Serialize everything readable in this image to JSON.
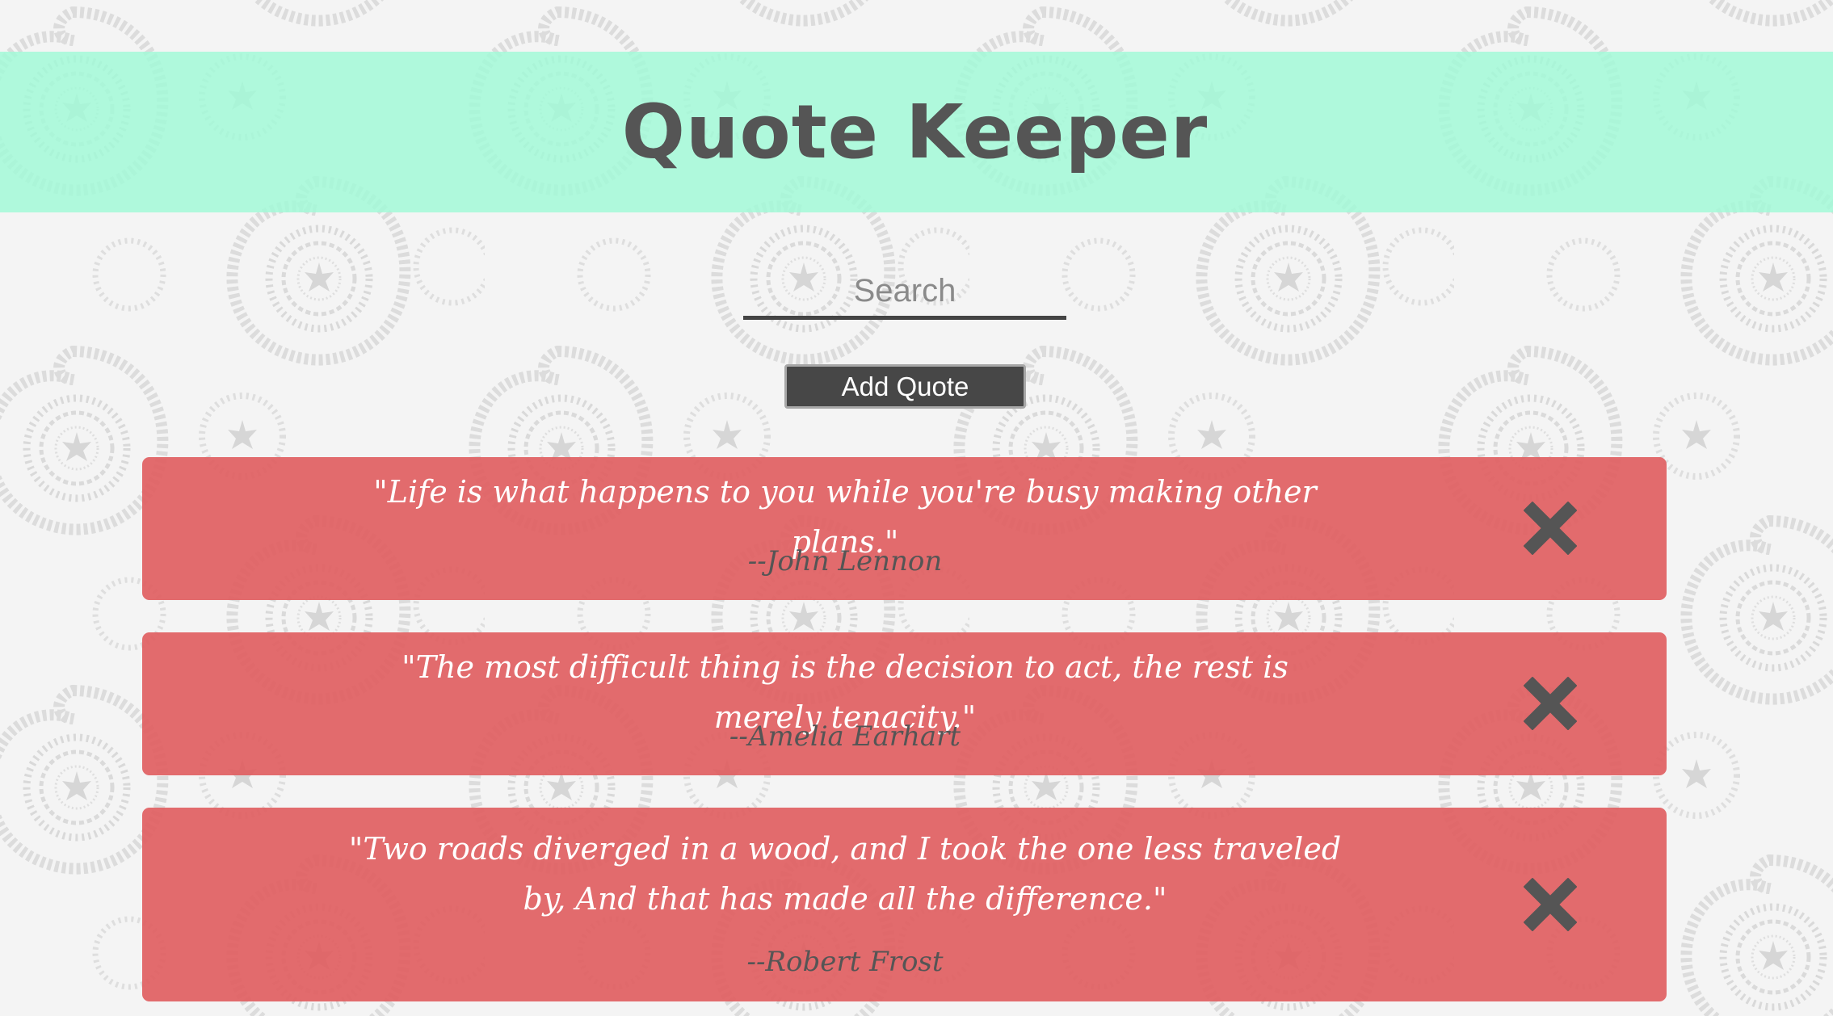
{
  "header": {
    "title": "Quote Keeper"
  },
  "search": {
    "placeholder": "Search"
  },
  "toolbar": {
    "add_label": "Add Quote"
  },
  "quotes": [
    {
      "text": "\"Life is what happens to you while you're busy making other plans.\"",
      "author": "--John Lennon"
    },
    {
      "text": "\"The most difficult thing is the decision to act, the rest is merely tenacity.\"",
      "author": "--Amelia Earhart"
    },
    {
      "text": "\"Two roads diverged in a wood, and I took the one less traveled by, And that has made all the difference.\"",
      "author": "--Robert Frost"
    }
  ],
  "icons": {
    "delete": "close-icon",
    "background": "paisley-pattern"
  },
  "colors": {
    "background": "#f4f4f4",
    "header": "#aff9de",
    "card": "#e16a6b",
    "button": "#474747",
    "text_dark": "#555555"
  }
}
